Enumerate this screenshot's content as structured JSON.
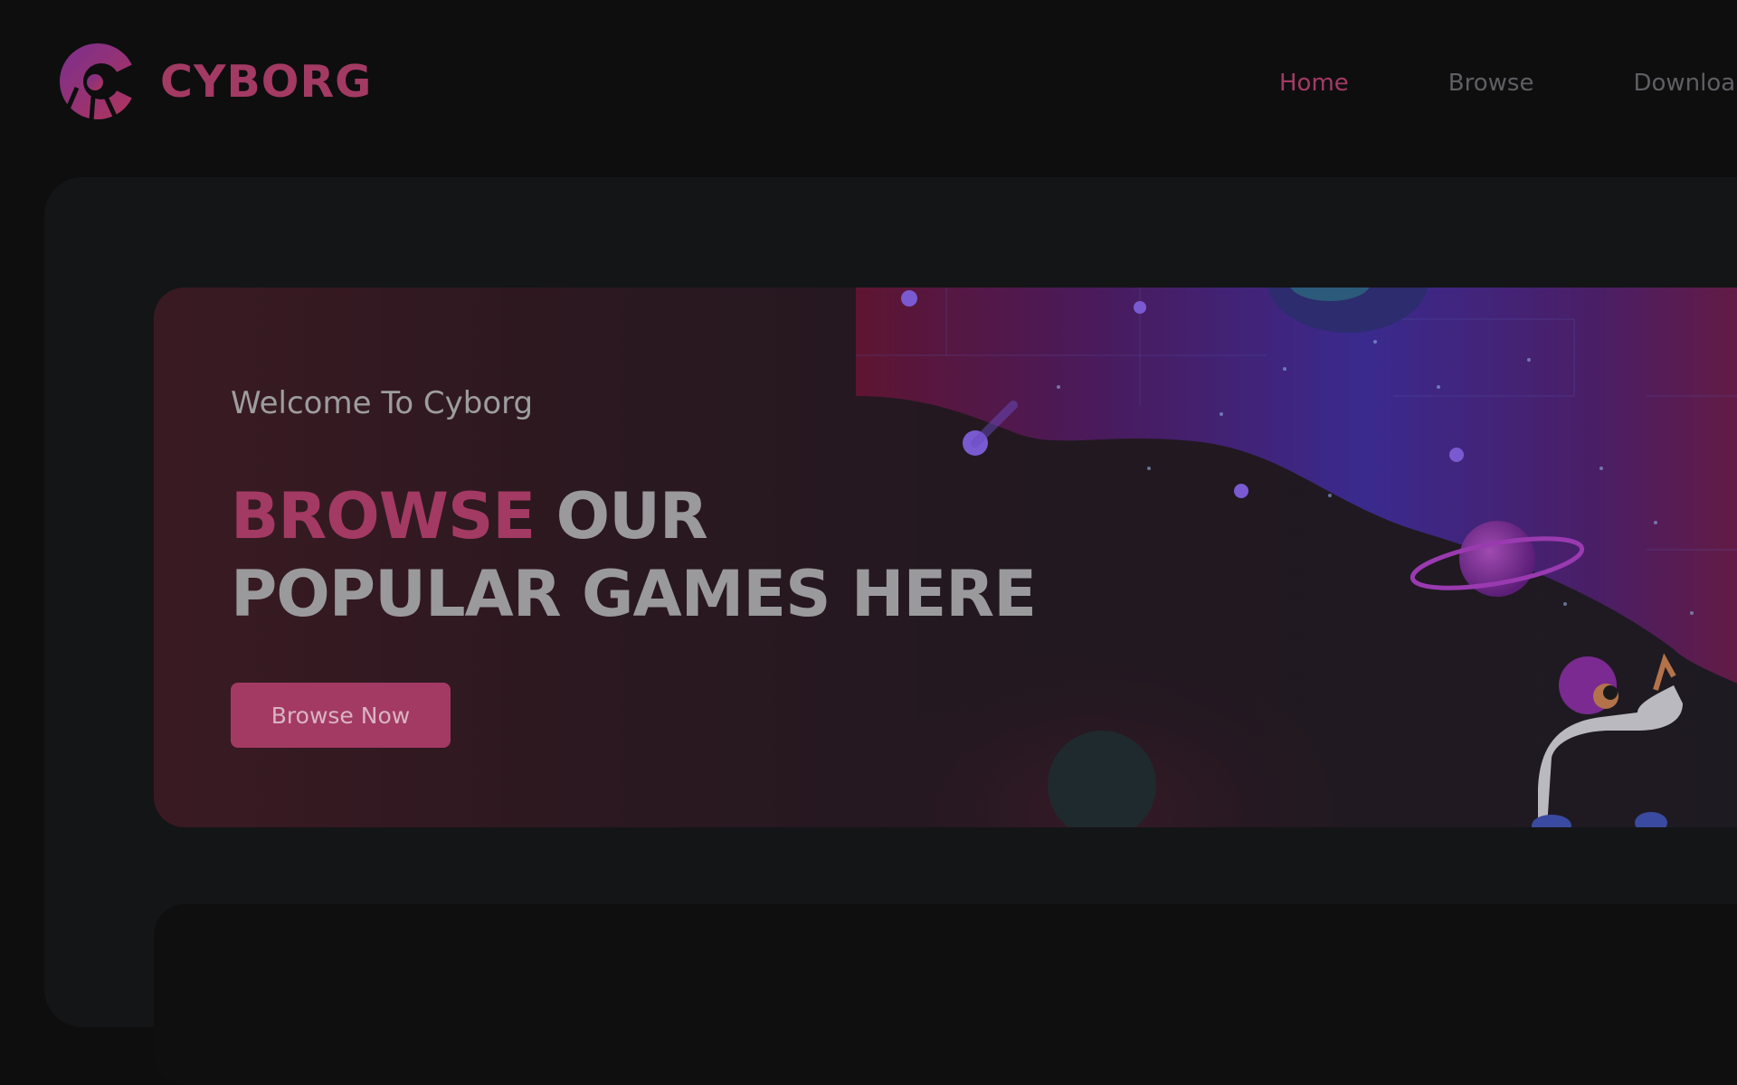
{
  "header": {
    "logo_text": "CYBORG",
    "nav": [
      {
        "label": "Home",
        "active": true
      },
      {
        "label": "Browse",
        "active": false
      },
      {
        "label": "Downloa",
        "active": false
      }
    ]
  },
  "banner": {
    "welcome": "Welcome To Cyborg",
    "headline_accent": "BROWSE",
    "headline_rest": " OUR",
    "headline_line2": "POPULAR GAMES HERE",
    "button_label": "Browse Now"
  },
  "colors": {
    "accent": "#a33a63",
    "page_background": "#0e0e0f",
    "panel_background": "#141517"
  },
  "icons": [
    "cyborg-logo-icon"
  ]
}
